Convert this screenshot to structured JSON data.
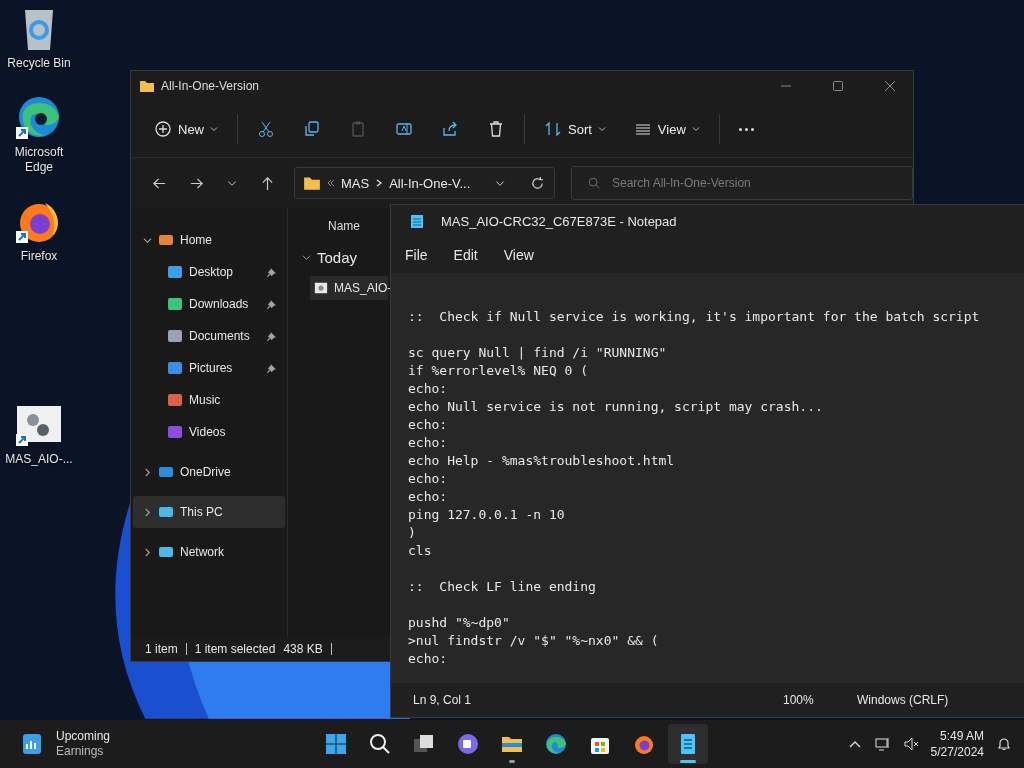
{
  "desktop_icons": [
    {
      "label": "Recycle Bin",
      "kind": "recycle",
      "shortcut": false
    },
    {
      "label": "Microsoft Edge",
      "kind": "edge",
      "shortcut": true
    },
    {
      "label": "Firefox",
      "kind": "firefox",
      "shortcut": true
    },
    {
      "label": "MAS_AIO-...",
      "kind": "script",
      "shortcut": true
    }
  ],
  "explorer": {
    "title": "All-In-One-Version",
    "toolbar": [
      {
        "kind": "new",
        "label": "New",
        "disabled": false
      },
      {
        "kind": "cut",
        "disabled": false
      },
      {
        "kind": "copy",
        "disabled": false
      },
      {
        "kind": "paste",
        "disabled": true
      },
      {
        "kind": "rename",
        "disabled": false
      },
      {
        "kind": "share",
        "disabled": false
      },
      {
        "kind": "delete",
        "disabled": false
      },
      {
        "kind": "sort",
        "label": "Sort",
        "disabled": false
      },
      {
        "kind": "view",
        "label": "View",
        "disabled": false
      },
      {
        "kind": "more",
        "disabled": false
      }
    ],
    "breadcrumb": [
      "MAS",
      "All-In-One-V..."
    ],
    "search": {
      "placeholder": "Search All-In-One-Version"
    },
    "sidebar": [
      {
        "label": "Home",
        "kind": "home",
        "expanded": true,
        "selected": false,
        "children": [
          {
            "label": "Desktop",
            "kind": "desktop",
            "pinned": true,
            "selected": false
          },
          {
            "label": "Downloads",
            "kind": "downloads",
            "pinned": true,
            "selected": false
          },
          {
            "label": "Documents",
            "kind": "documents",
            "pinned": true,
            "selected": false
          },
          {
            "label": "Pictures",
            "kind": "pictures",
            "pinned": true,
            "selected": false
          },
          {
            "label": "Music",
            "kind": "music",
            "pinned": false,
            "selected": false
          },
          {
            "label": "Videos",
            "kind": "videos",
            "pinned": false,
            "selected": false
          }
        ]
      },
      {
        "label": "OneDrive",
        "kind": "cloud",
        "expanded": false,
        "selected": false
      },
      {
        "label": "This PC",
        "kind": "pc",
        "expanded": false,
        "selected": true
      },
      {
        "label": "Network",
        "kind": "network",
        "expanded": false,
        "selected": false
      }
    ],
    "columns": [
      "Name"
    ],
    "groups": [
      {
        "label": "Today",
        "expanded": true,
        "files": [
          {
            "name": "MAS_AIO-",
            "selected": true
          }
        ]
      }
    ],
    "status": [
      "1 item",
      "1 item selected",
      "438 KB"
    ]
  },
  "notepad": {
    "title": "MAS_AIO-CRC32_C67E873E - Notepad",
    "menu": [
      "File",
      "Edit",
      "View"
    ],
    "blocks": [
      [
        "::  Check if Null service is working, it's important for the batch script"
      ],
      [
        "sc query Null | find /i \"RUNNING\"",
        "if %errorlevel% NEQ 0 (",
        "echo:",
        "echo Null service is not running, script may crash...",
        "echo:",
        "echo:",
        "echo Help - %mas%troubleshoot.html",
        "echo:",
        "echo:",
        "ping 127.0.0.1 -n 10",
        ")",
        "cls"
      ],
      [
        "::  Check LF line ending"
      ],
      [
        "pushd \"%~dp0\"",
        ">nul findstr /v \"$\" \"%~nx0\" && (",
        "echo:"
      ]
    ],
    "status": [
      "Ln 9, Col 1",
      "100%",
      "Windows (CRLF)"
    ]
  },
  "taskbar": {
    "widget": {
      "title": "Upcoming",
      "subtitle": "Earnings"
    },
    "apps": [
      {
        "kind": "start",
        "running": false,
        "active": false
      },
      {
        "kind": "search",
        "running": false,
        "active": false
      },
      {
        "kind": "taskview",
        "running": false,
        "active": false
      },
      {
        "kind": "chat",
        "running": false,
        "active": false
      },
      {
        "kind": "explorer",
        "running": true,
        "active": false
      },
      {
        "kind": "edge",
        "running": false,
        "active": false
      },
      {
        "kind": "store",
        "running": false,
        "active": false
      },
      {
        "kind": "firefox",
        "running": false,
        "active": false
      },
      {
        "kind": "notepad",
        "running": true,
        "active": true
      }
    ],
    "time": "5:49 AM",
    "date": "5/27/2024"
  }
}
